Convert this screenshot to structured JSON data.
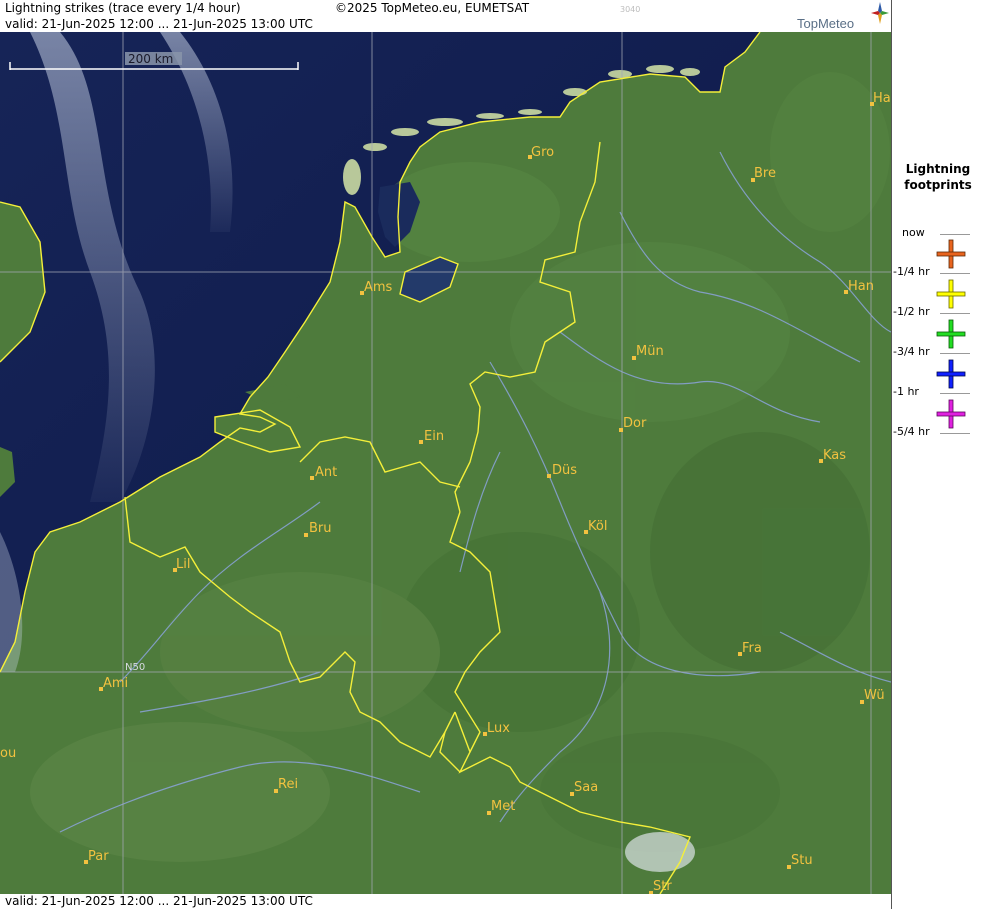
{
  "header": {
    "title": "Lightning strikes (trace every 1/4 hour)",
    "copyright": "©2025 TopMeteo.eu, EUMETSAT",
    "code": "3040",
    "valid": "valid:  21-Jun-2025 12:00 ... 21-Jun-2025 13:00 UTC"
  },
  "logo": {
    "text": "TopMeteo",
    "icon": "compass-star-icon"
  },
  "footer": {
    "valid": "valid:  21-Jun-2025 12:00 ... 21-Jun-2025 13:00 UTC"
  },
  "scale": {
    "label": "200 km"
  },
  "latitude_label": "N50",
  "cities": [
    {
      "id": "gro",
      "label": "Gro"
    },
    {
      "id": "bre",
      "label": "Bre"
    },
    {
      "id": "ha",
      "label": "Ha"
    },
    {
      "id": "ams",
      "label": "Ams"
    },
    {
      "id": "han",
      "label": "Han"
    },
    {
      "id": "mun",
      "label": "Mün"
    },
    {
      "id": "dor",
      "label": "Dor"
    },
    {
      "id": "ein",
      "label": "Ein"
    },
    {
      "id": "kas",
      "label": "Kas"
    },
    {
      "id": "ant",
      "label": "Ant"
    },
    {
      "id": "dus",
      "label": "Düs"
    },
    {
      "id": "bru",
      "label": "Bru"
    },
    {
      "id": "kol",
      "label": "Köl"
    },
    {
      "id": "lil",
      "label": "Lil"
    },
    {
      "id": "fra",
      "label": "Fra"
    },
    {
      "id": "ami",
      "label": "Ami"
    },
    {
      "id": "wu",
      "label": "Wü"
    },
    {
      "id": "lux",
      "label": "Lux"
    },
    {
      "id": "ou",
      "label": "ou"
    },
    {
      "id": "rei",
      "label": "Rei"
    },
    {
      "id": "saa",
      "label": "Saa"
    },
    {
      "id": "met",
      "label": "Met"
    },
    {
      "id": "par",
      "label": "Par"
    },
    {
      "id": "stu",
      "label": "Stu"
    },
    {
      "id": "str",
      "label": "Str"
    }
  ],
  "legend": {
    "title_line1": "Lightning",
    "title_line2": "footprints",
    "levels": [
      {
        "label": "now"
      },
      {
        "label": "-1/4 hr",
        "color": "#e8641e"
      },
      {
        "label": "-1/2 hr",
        "color": "#ffff00"
      },
      {
        "label": "-3/4 hr",
        "color": "#22dd22"
      },
      {
        "label": "-1 hr",
        "color": "#1020ff"
      },
      {
        "label": "-5/4 hr",
        "color": "#e020e0"
      }
    ]
  },
  "colors": {
    "sea": "#0f1c4e",
    "land": "#4f7a3f",
    "border": "#f4ef3a",
    "city": "#f2c240",
    "grid": "#9aa0aa",
    "river": "#8aa0d8"
  }
}
